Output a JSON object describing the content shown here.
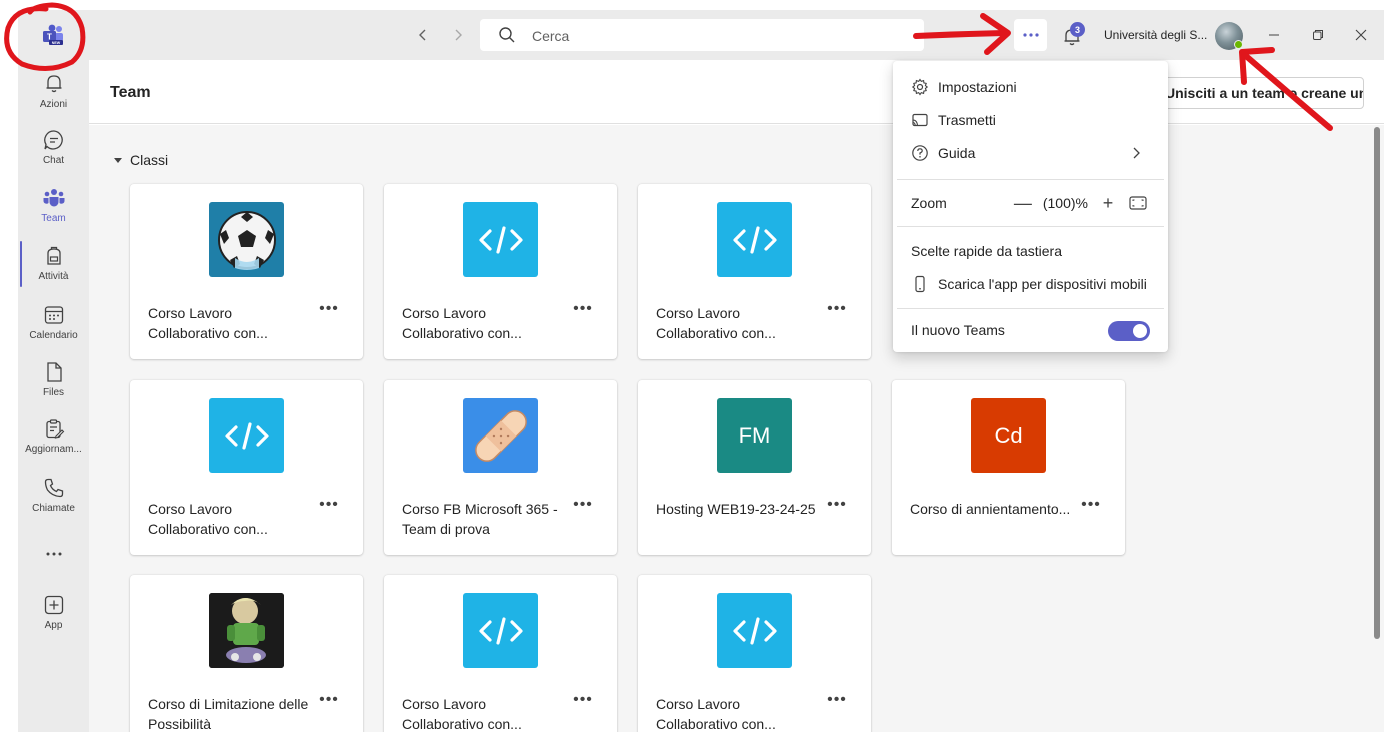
{
  "titlebar": {
    "app_logo_badge": "NEW",
    "back_icon": "chevron-left-icon",
    "forward_icon": "chevron-right-icon",
    "search_placeholder": "Cerca",
    "more_label": "•••",
    "notifications_count": "3",
    "org_name": "Università degli S..."
  },
  "rail": {
    "items": [
      {
        "label": "Azioni",
        "icon": "bell-icon"
      },
      {
        "label": "Chat",
        "icon": "chat-icon"
      },
      {
        "label": "Team",
        "icon": "teams-icon",
        "active": true
      },
      {
        "label": "Attività",
        "icon": "backpack-icon"
      },
      {
        "label": "Calendario",
        "icon": "calendar-icon"
      },
      {
        "label": "Files",
        "icon": "file-icon"
      },
      {
        "label": "Aggiornam...",
        "icon": "clipboard-edit-icon"
      },
      {
        "label": "Chiamate",
        "icon": "phone-icon"
      },
      {
        "label": "•••",
        "icon": "more-icon"
      },
      {
        "label": "App",
        "icon": "add-app-icon"
      }
    ]
  },
  "header": {
    "title": "Team",
    "join_button": "Unisciti a un team o creane uno"
  },
  "section": {
    "label": "Classi"
  },
  "cards": [
    {
      "title": "Corso Lavoro Collaborativo con...",
      "image": "soccer-ball-icon",
      "bg": "#1f7fa8"
    },
    {
      "title": "Corso Lavoro Collaborativo con...",
      "image": "code-icon",
      "bg": "#1fb3e6"
    },
    {
      "title": "Corso Lavoro Collaborativo con...",
      "image": "code-icon",
      "bg": "#1fb3e6"
    },
    {
      "title": "Corso Lavoro Collaborativo con...",
      "image": "code-icon",
      "bg": "#1fb3e6"
    },
    {
      "title": "Corso FB Microsoft 365 -Team di prova",
      "image": "bandage-icon",
      "bg": "#3a8ee8"
    },
    {
      "title": "Hosting WEB19-23-24-25",
      "image": "initials",
      "initials": "FM",
      "bg": "#1a8a84"
    },
    {
      "title": "Corso di annientamento...",
      "image": "initials",
      "initials": "Cd",
      "bg": "#d83b01"
    },
    {
      "title": "Corso di Limitazione delle Possibilità",
      "image": "character-icon",
      "bg": "#1b1b1b"
    },
    {
      "title": "Corso Lavoro Collaborativo con...",
      "image": "code-icon",
      "bg": "#1fb3e6"
    },
    {
      "title": "Corso Lavoro Collaborativo con...",
      "image": "code-icon",
      "bg": "#1fb3e6"
    }
  ],
  "card_more_label": "•••",
  "menu": {
    "settings": "Impostazioni",
    "cast": "Trasmetti",
    "help": "Guida",
    "zoom_label": "Zoom",
    "zoom_minus": "—",
    "zoom_value": "(100)%",
    "zoom_plus": "+",
    "shortcuts": "Scelte rapide da tastiera",
    "mobile_app": "Scarica l'app per dispositivi mobili",
    "new_teams": "Il nuovo Teams",
    "new_teams_on": true
  },
  "colors": {
    "accent": "#5b5fc7",
    "annotation": "#e0161c"
  }
}
